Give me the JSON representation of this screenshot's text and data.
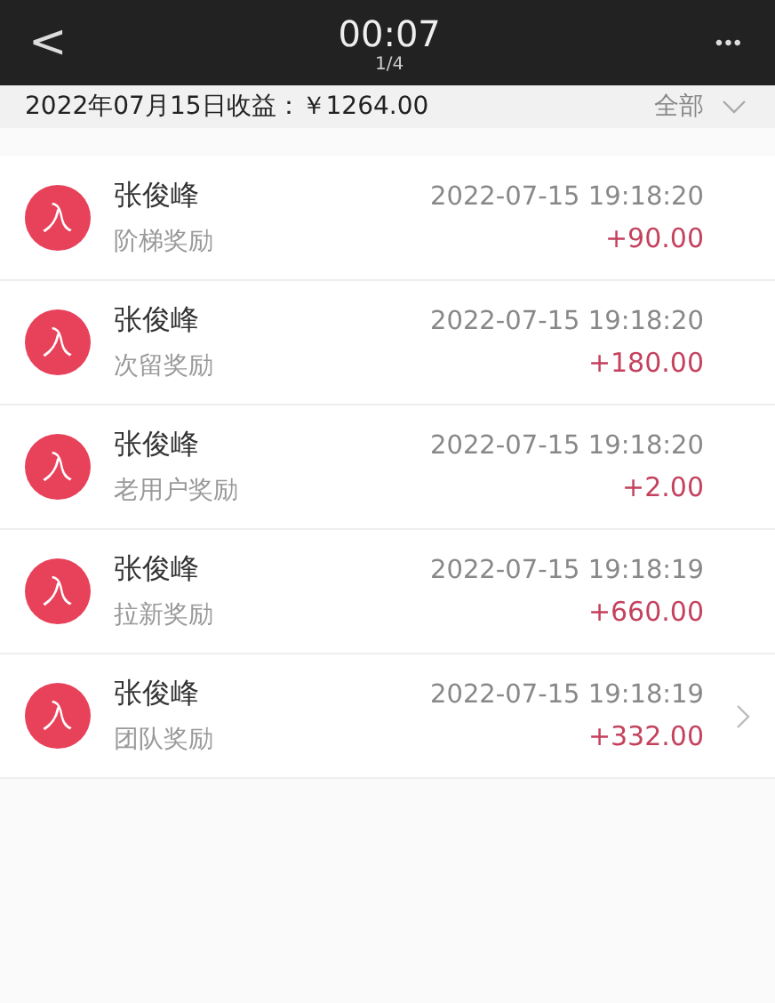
{
  "header": {
    "back": "<",
    "title": "00:07",
    "subtitle": "1/4",
    "more": "•••"
  },
  "summary": {
    "label": "2022年07月15日收益：￥1264.00",
    "filter": "全部"
  },
  "records": [
    {
      "badge": "入",
      "name": "张俊峰",
      "type": "阶梯奖励",
      "time": "2022-07-15 19:18:20",
      "amount": "+90.00",
      "has_arrow": false
    },
    {
      "badge": "入",
      "name": "张俊峰",
      "type": "次留奖励",
      "time": "2022-07-15 19:18:20",
      "amount": "+180.00",
      "has_arrow": false
    },
    {
      "badge": "入",
      "name": "张俊峰",
      "type": "老用户奖励",
      "time": "2022-07-15 19:18:20",
      "amount": "+2.00",
      "has_arrow": false
    },
    {
      "badge": "入",
      "name": "张俊峰",
      "type": "拉新奖励",
      "time": "2022-07-15 19:18:19",
      "amount": "+660.00",
      "has_arrow": false
    },
    {
      "badge": "入",
      "name": "张俊峰",
      "type": "团队奖励",
      "time": "2022-07-15 19:18:19",
      "amount": "+332.00",
      "has_arrow": true
    }
  ]
}
